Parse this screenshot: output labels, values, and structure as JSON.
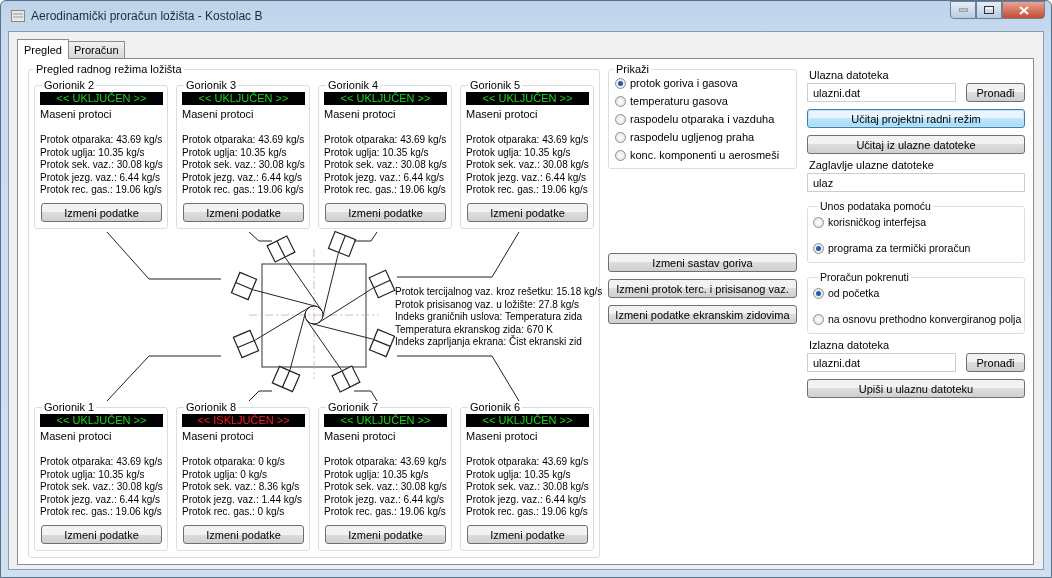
{
  "window": {
    "title": "Aerodinamički proračun ložišta - Kostolac B"
  },
  "tabs": [
    {
      "label": "Pregled",
      "selected": true
    },
    {
      "label": "Proračun",
      "selected": false
    }
  ],
  "overview": {
    "title": "Pregled radnog režima ložišta",
    "burners_top": [
      {
        "name": "Gorionik 2",
        "on": true,
        "status": "<< UKLJUČEN >>",
        "section": "Maseni protoci",
        "rows": [
          "Protok otparaka:  43.69 kg/s",
          "Protok uglja:  10.35 kg/s",
          "Protok sek. vaz.:  30.08 kg/s",
          "Protok jezg. vaz.:  6.44 kg/s",
          "Protok rec. gas.:  19.06 kg/s"
        ],
        "button": "Izmeni podatke"
      },
      {
        "name": "Gorionik 3",
        "on": true,
        "status": "<< UKLJUČEN >>",
        "section": "Maseni protoci",
        "rows": [
          "Protok otparaka:  43.69 kg/s",
          "Protok uglja:  10.35 kg/s",
          "Protok sek. vaz.:  30.08 kg/s",
          "Protok jezg. vaz.:  6.44 kg/s",
          "Protok rec. gas.:  19.06 kg/s"
        ],
        "button": "Izmeni podatke"
      },
      {
        "name": "Gorionik 4",
        "on": true,
        "status": "<< UKLJUČEN >>",
        "section": "Maseni protoci",
        "rows": [
          "Protok otparaka:  43.69 kg/s",
          "Protok uglja:  10.35 kg/s",
          "Protok sek. vaz.:  30.08 kg/s",
          "Protok jezg. vaz.:  6.44 kg/s",
          "Protok rec. gas.:  19.06 kg/s"
        ],
        "button": "Izmeni podatke"
      },
      {
        "name": "Gorionik 5",
        "on": true,
        "status": "<< UKLJUČEN >>",
        "section": "Maseni protoci",
        "rows": [
          "Protok otparaka:  43.69 kg/s",
          "Protok uglja:  10.35 kg/s",
          "Protok sek. vaz.:  30.08 kg/s",
          "Protok jezg. vaz.:  6.44 kg/s",
          "Protok rec. gas.:  19.06 kg/s"
        ],
        "button": "Izmeni podatke"
      }
    ],
    "info_lines": [
      "Protok tercijalnog vaz. kroz rešetku:  15.18 kg/s",
      "Protok prisisanog vaz. u ložište: 27.8 kg/s",
      "Indeks graničnih uslova: Temperatura zida",
      "Temperatura ekranskog zida: 670 K",
      "Indeks zaprljanja ekrana: Čist ekranski zid"
    ],
    "burners_bottom": [
      {
        "name": "Gorionik 1",
        "on": true,
        "status": "<< UKLJUČEN >>",
        "section": "Maseni protoci",
        "rows": [
          "Protok otparaka:  43.69 kg/s",
          "Protok uglja:  10.35 kg/s",
          "Protok sek. vaz.:  30.08 kg/s",
          "Protok jezg. vaz.:  6.44 kg/s",
          "Protok rec. gas.:  19.06 kg/s"
        ],
        "button": "Izmeni podatke"
      },
      {
        "name": "Gorionik 8",
        "on": false,
        "status": "<< ISKLJUČEN >>",
        "section": "Maseni protoci",
        "rows": [
          "Protok otparaka:  0 kg/s",
          "Protok uglja:  0 kg/s",
          "Protok sek. vaz.:  8.36 kg/s",
          "Protok jezg. vaz.:  1.44 kg/s",
          "Protok rec. gas.:  0 kg/s"
        ],
        "button": "Izmeni podatke"
      },
      {
        "name": "Gorionik 7",
        "on": true,
        "status": "<< UKLJUČEN >>",
        "section": "Maseni protoci",
        "rows": [
          "Protok otparaka:  43.69 kg/s",
          "Protok uglja:  10.35 kg/s",
          "Protok sek. vaz.:  30.08 kg/s",
          "Protok jezg. vaz.:  6.44 kg/s",
          "Protok rec. gas.:  19.06 kg/s"
        ],
        "button": "Izmeni podatke"
      },
      {
        "name": "Gorionik 6",
        "on": true,
        "status": "<< UKLJUČEN >>",
        "section": "Maseni protoci",
        "rows": [
          "Protok otparaka:  43.69 kg/s",
          "Protok uglja:  10.35 kg/s",
          "Protok sek. vaz.:  30.08 kg/s",
          "Protok jezg. vaz.:  6.44 kg/s",
          "Protok rec. gas.:  19.06 kg/s"
        ],
        "button": "Izmeni podatke"
      }
    ]
  },
  "display": {
    "title": "Prikaži",
    "options": [
      {
        "label": "protok goriva i gasova",
        "selected": true
      },
      {
        "label": "temperaturu gasova",
        "selected": false
      },
      {
        "label": "raspodelu otparaka i vazduha",
        "selected": false
      },
      {
        "label": "raspodelu ugljenog praha",
        "selected": false
      },
      {
        "label": "konc. komponenti u aerosmeši",
        "selected": false
      }
    ]
  },
  "actions": [
    "Izmeni sastav goriva",
    "Izmeni protok terc. i prisisanog vaz.",
    "Izmeni podatke ekranskim zidovima"
  ],
  "input_file": {
    "label": "Ulazna datoteka",
    "value": "ulazni.dat",
    "button": "Pronađi"
  },
  "load_buttons": [
    {
      "label": "Učitaj projektni radni režim",
      "highlighted": true
    },
    {
      "label": "Učitaj iz ulazne datoteke",
      "highlighted": false
    }
  ],
  "header": {
    "label": "Zaglavlje ulazne datoteke",
    "value": "ulaz"
  },
  "data_entry": {
    "title": "Unos podataka pomoću",
    "options": [
      {
        "label": "korisničkog interfejsa",
        "selected": false
      },
      {
        "label": "programa za termički proračun",
        "selected": true
      }
    ]
  },
  "start": {
    "title": "Proračun pokrenuti",
    "options": [
      {
        "label": "od početka",
        "selected": true
      },
      {
        "label": "na osnovu prethodno konvergiranog polja",
        "selected": false
      }
    ]
  },
  "output_file": {
    "label": "Izlazna datoteka",
    "value": "ulazni.dat",
    "button": "Pronađi"
  },
  "write_button": "Upiši u ulaznu datoteku"
}
